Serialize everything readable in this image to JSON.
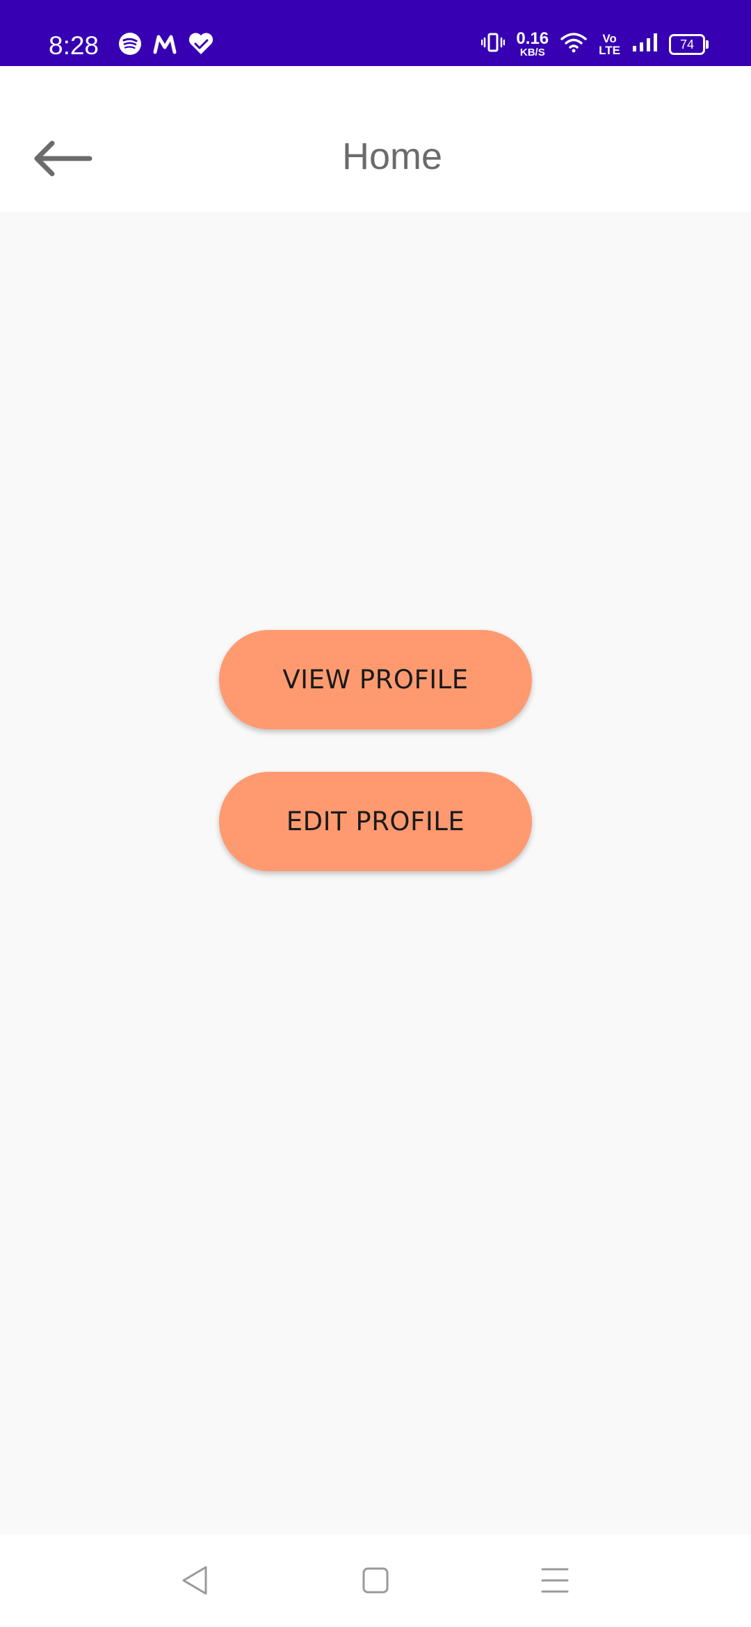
{
  "status_bar": {
    "time": "8:28",
    "left_icons": [
      "spotify-icon",
      "myntra-icon",
      "health-heart-icon"
    ],
    "net_speed_value": "0.16",
    "net_speed_unit": "KB/S",
    "volte_top": "Vo",
    "volte_bottom": "LTE",
    "battery_level": "74",
    "background_color": "#3700b3"
  },
  "app_bar": {
    "title": "Home",
    "back_icon": "arrow-left-icon"
  },
  "main": {
    "view_profile_label": "VIEW PROFILE",
    "edit_profile_label": "EDIT PROFILE",
    "button_color": "#ff9a70"
  },
  "nav_bar": {
    "icons": [
      "back-triangle-icon",
      "home-square-icon",
      "menu-lines-icon"
    ]
  }
}
